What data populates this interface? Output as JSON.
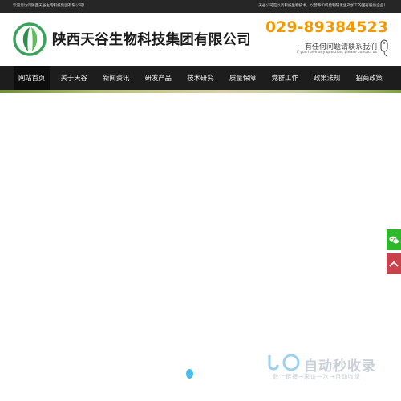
{
  "topbar": {
    "welcome": "欢迎您访问陕西天谷生物科技集团有限公司！",
    "intro": "天谷公司是以高科技生物技术，以营养和机能制研发生产加工的国有股份企业！"
  },
  "header": {
    "company_name": "陕西天谷生物科技集团有限公司",
    "phone": "029-89384523",
    "hint_cn": "有任何问题请联系我们",
    "hint_en": "If you have any question, please contact us",
    "logo_icon": "leaf-logo-icon",
    "phone_icon": "mouse-icon"
  },
  "nav": {
    "items": [
      {
        "label": "网站首页"
      },
      {
        "label": "关于天谷"
      },
      {
        "label": "新闻资讯"
      },
      {
        "label": "研发产品"
      },
      {
        "label": "技术研究"
      },
      {
        "label": "质量保障"
      },
      {
        "label": "党群工作"
      },
      {
        "label": "政策法规"
      },
      {
        "label": "招商政策"
      }
    ]
  },
  "side_buttons": {
    "wechat_icon": "wechat-icon",
    "top_icon": "arrow-up-icon"
  },
  "watermark": {
    "title": "自动秒收录",
    "subtitle": "数上链接→来访一次→自动收录"
  },
  "colors": {
    "accent_phone": "#f39800",
    "nav_bg": "#1d1d1d",
    "topbar_bg": "#262626",
    "wechat_green": "#2db829",
    "top_red": "#c8434b",
    "dot_blue": "#4bbde8"
  }
}
